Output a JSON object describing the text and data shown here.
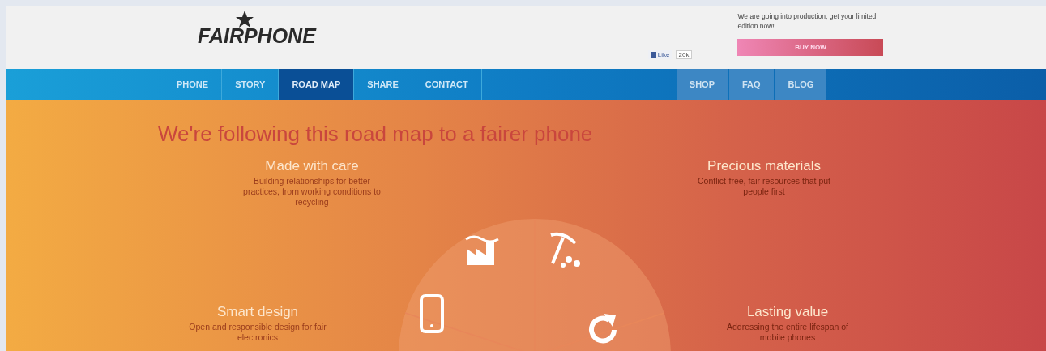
{
  "header": {
    "logo": "FAIRPHONE",
    "like": {
      "label": "Like",
      "count": "20k"
    },
    "promo": "We are going into production, get your limited edition now!",
    "buy_button": "BUY NOW"
  },
  "nav": {
    "left": [
      {
        "label": "PHONE",
        "selected": false
      },
      {
        "label": "STORY",
        "selected": false
      },
      {
        "label": "ROAD MAP",
        "selected": true
      },
      {
        "label": "SHARE",
        "selected": false
      },
      {
        "label": "CONTACT",
        "selected": false
      }
    ],
    "right": [
      {
        "label": "SHOP",
        "selected": false
      },
      {
        "label": "FAQ",
        "selected": false
      },
      {
        "label": "BLOG",
        "selected": false
      }
    ]
  },
  "hero": {
    "title": "We're following this road map to a fairer phone",
    "left": [
      {
        "title": "Made with care",
        "description": "Building relationships for better practices, from working conditions to recycling"
      },
      {
        "title": "Smart design",
        "description": "Open and responsible design for fair electronics"
      }
    ],
    "right": [
      {
        "title": "Precious materials",
        "description": "Conflict-free, fair resources that put people first"
      },
      {
        "title": "Lasting value",
        "description": "Addressing the entire lifespan of mobile phones"
      }
    ]
  }
}
